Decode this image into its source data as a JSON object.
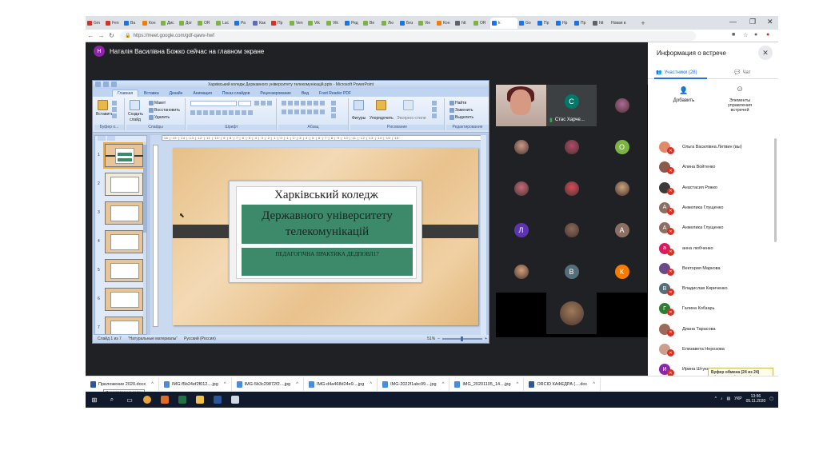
{
  "browser": {
    "tabs": [
      {
        "label": "Gm",
        "color": "#d93025"
      },
      {
        "label": "Fen",
        "color": "#d93025"
      },
      {
        "label": "Ва",
        "color": "#1a73e8"
      },
      {
        "label": "Кон",
        "color": "#f57c00"
      },
      {
        "label": "Дис",
        "color": "#7cb342"
      },
      {
        "label": "Дог",
        "color": "#7cb342"
      },
      {
        "label": "OR",
        "color": "#7cb342"
      },
      {
        "label": "Luc",
        "color": "#7cb342"
      },
      {
        "label": "Ра",
        "color": "#1a73e8"
      },
      {
        "label": "Как",
        "color": "#5c6bc0"
      },
      {
        "label": "Пр",
        "color": "#d93025"
      },
      {
        "label": "Ven",
        "color": "#7cb342"
      },
      {
        "label": "Vik",
        "color": "#7cb342"
      },
      {
        "label": "Vik",
        "color": "#7cb342"
      },
      {
        "label": "Ред",
        "color": "#1a73e8"
      },
      {
        "label": "Ве",
        "color": "#7cb342"
      },
      {
        "label": "Лю",
        "color": "#7cb342"
      },
      {
        "label": "Без",
        "color": "#1a73e8"
      },
      {
        "label": "Vie",
        "color": "#7cb342"
      },
      {
        "label": "Кон",
        "color": "#f57c00"
      },
      {
        "label": "htt",
        "color": "#5f6368"
      },
      {
        "label": "OR",
        "color": "#7cb342"
      }
    ],
    "active_tab": {
      "label": "k",
      "color": "#1a73e8"
    },
    "tabs_after": [
      {
        "label": "Go",
        "color": "#1a73e8"
      },
      {
        "label": "Пр",
        "color": "#1a73e8"
      },
      {
        "label": "Нр",
        "color": "#1a73e8"
      },
      {
        "label": "Пр",
        "color": "#1a73e8"
      },
      {
        "label": "htt",
        "color": "#5f6368"
      }
    ],
    "new_tab_label": "Новая в",
    "url": "https://meet.google.com/gdf-qawv-hwf"
  },
  "meet": {
    "presenter_initial": "Н",
    "presenter_text": "Наталія Василівна Божко сейчас на главном экране",
    "panel_title": "Информация о встрече",
    "tab_participants": "Участники (28)",
    "tab_chat": "Чат",
    "add_label": "Добавить",
    "controls_label_1": "Элементы",
    "controls_label_2": "управления",
    "controls_label_3": "встречей",
    "stas_name": "Стас Харче...",
    "tiles": [
      {
        "initial": "С",
        "color": "#00796b",
        "photo": false
      },
      {
        "initial": "",
        "color": "#b0689a",
        "photo": true
      },
      {
        "initial": "",
        "color": "#c89a88",
        "photo": true
      },
      {
        "initial": "",
        "color": "#b24a6a",
        "photo": true
      },
      {
        "initial": "О",
        "color": "#7cb342",
        "photo": false
      },
      {
        "initial": "",
        "color": "#c56a7a",
        "photo": true
      },
      {
        "initial": "",
        "color": "#d84a5a",
        "photo": true
      },
      {
        "initial": "",
        "color": "#c9a27a",
        "photo": true
      },
      {
        "initial": "Л",
        "color": "#5e35b1",
        "photo": false
      },
      {
        "initial": "",
        "color": "#8a6a5a",
        "photo": true
      },
      {
        "initial": "А",
        "color": "#8d6e63",
        "photo": false
      },
      {
        "initial": "",
        "color": "#d4a07a",
        "photo": true
      },
      {
        "initial": "В",
        "color": "#546e7a",
        "photo": false
      },
      {
        "initial": "К",
        "color": "#f57c00",
        "photo": false
      },
      {
        "initial": "",
        "color": "#a07a5a",
        "photo": true
      }
    ],
    "participants": [
      {
        "name": "Ольга Василівна Литвин (вы)",
        "initial": "",
        "color": "#e08a6a"
      },
      {
        "name": "Алина Войтенко",
        "initial": "",
        "color": "#8a5a4a"
      },
      {
        "name": "Анастасия Рожко",
        "initial": "",
        "color": "#3a3a3a"
      },
      {
        "name": "Анжелика Глущенко",
        "initial": "А",
        "color": "#8d6e63"
      },
      {
        "name": "Анжелика Глущенко",
        "initial": "А",
        "color": "#8d6e63"
      },
      {
        "name": "анна любченко",
        "initial": "а",
        "color": "#d81b60"
      },
      {
        "name": "Вектория Маркова",
        "initial": "",
        "color": "#6a4a8a"
      },
      {
        "name": "Владислав Кириченко",
        "initial": "В",
        "color": "#546e7a"
      },
      {
        "name": "Галина Кобзарь",
        "initial": "Г",
        "color": "#2e7d32"
      },
      {
        "name": "Диана Тарасова",
        "initial": "",
        "color": "#9a6a5a"
      },
      {
        "name": "Елизавета Нерозова",
        "initial": "",
        "color": "#caa08a"
      },
      {
        "name": "Ирина Штукань",
        "initial": "И",
        "color": "#8e24aa"
      },
      {
        "name": "Карина",
        "initial": "К",
        "color": "#f57c00"
      }
    ]
  },
  "ppt": {
    "window_title": "Харківський коледж Державного університету телекомунікацій.pptx - Microsoft PowerPoint",
    "tabs": [
      "Главная",
      "Вставка",
      "Дизайн",
      "Анимация",
      "Показ слайдов",
      "Рецензирование",
      "Вид",
      "Foxit Reader PDF"
    ],
    "ribbon": {
      "paste": "Вставить",
      "create_slide_1": "Создать",
      "create_slide_2": "слайд",
      "layout": "Макет",
      "restore": "Восстановить",
      "delete": "Удалить",
      "figures": "Фигуры",
      "arrange": "Упорядочить",
      "quick_styles": "Экспресс-стили",
      "find": "Найти",
      "replace": "Заменить",
      "select": "Выделить",
      "group_clipboard": "Буфер о...",
      "group_slides": "Слайды",
      "group_font": "Шрифт",
      "group_paragraph": "Абзац",
      "group_drawing": "Рисование",
      "group_editing": "Редактирование"
    },
    "ruler": "·16·|·15·|·14·|·13·|·12·|·11·|·10·|·9·|·8·|·7·|·6·|·5·|·4·|·3·|·2·|·1·|·0·|·1·|·2·|·3·|·4·|·5·|·6·|·7·|·8·|·9·|·10·|·11·|·12·|·13·|·14·|·15·|·16·",
    "slide": {
      "title1": "Харківський коледж",
      "title2": "Державного університету",
      "title3": "телекомунікацій",
      "subtitle": "ПЕДАГОГІЧНА ПРАКТИКА ДЕДПОВЛ17"
    },
    "thumb_numbers": [
      "1",
      "2",
      "3",
      "4",
      "5",
      "6",
      "7"
    ],
    "status_slide": "Слайд 1 из 7",
    "status_theme": "\"Натуральные материалы\"",
    "status_lang": "Русский (Россия)",
    "zoom": "51%"
  },
  "downloads": [
    {
      "name": "Приложение 2020.docx",
      "type": "doc"
    },
    {
      "name": "IMG-f5b24ef2f012....jpg",
      "type": "img"
    },
    {
      "name": "IMG-5b3c29872f2....jpg",
      "type": "img"
    },
    {
      "name": "IMG-d4a468d24e9....jpg",
      "type": "img"
    },
    {
      "name": "IMG-2022f1abc99....jpg",
      "type": "img"
    },
    {
      "name": "IMG_20201105_14....jpg",
      "type": "img"
    },
    {
      "name": "ORCID КАФЕДРА (....doc",
      "type": "doc"
    }
  ],
  "dl_tooltip": "Представление задач",
  "clipboard_tip": {
    "title": "Буфер обмена (24 из 24)",
    "line1": "Объект не добавлен в буфер:",
    "line2": "удалите объекты для увеличения",
    "line3": "доступного места"
  },
  "taskbar": {
    "lang": "УКР",
    "time": "13:56",
    "date": "05.11.2020"
  }
}
